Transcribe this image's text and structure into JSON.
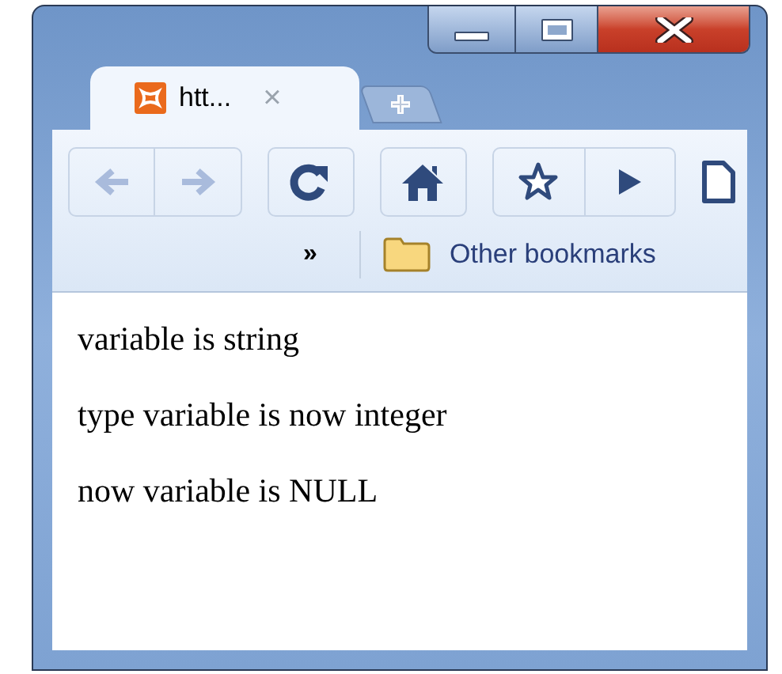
{
  "tab": {
    "title": "htt...",
    "close": "×",
    "selected": true
  },
  "bookmarks_bar": {
    "overflow": "»",
    "folder": "Other bookmarks"
  },
  "content": {
    "lines": [
      "variable is string",
      "type variable is now integer",
      "now variable is NULL"
    ]
  }
}
